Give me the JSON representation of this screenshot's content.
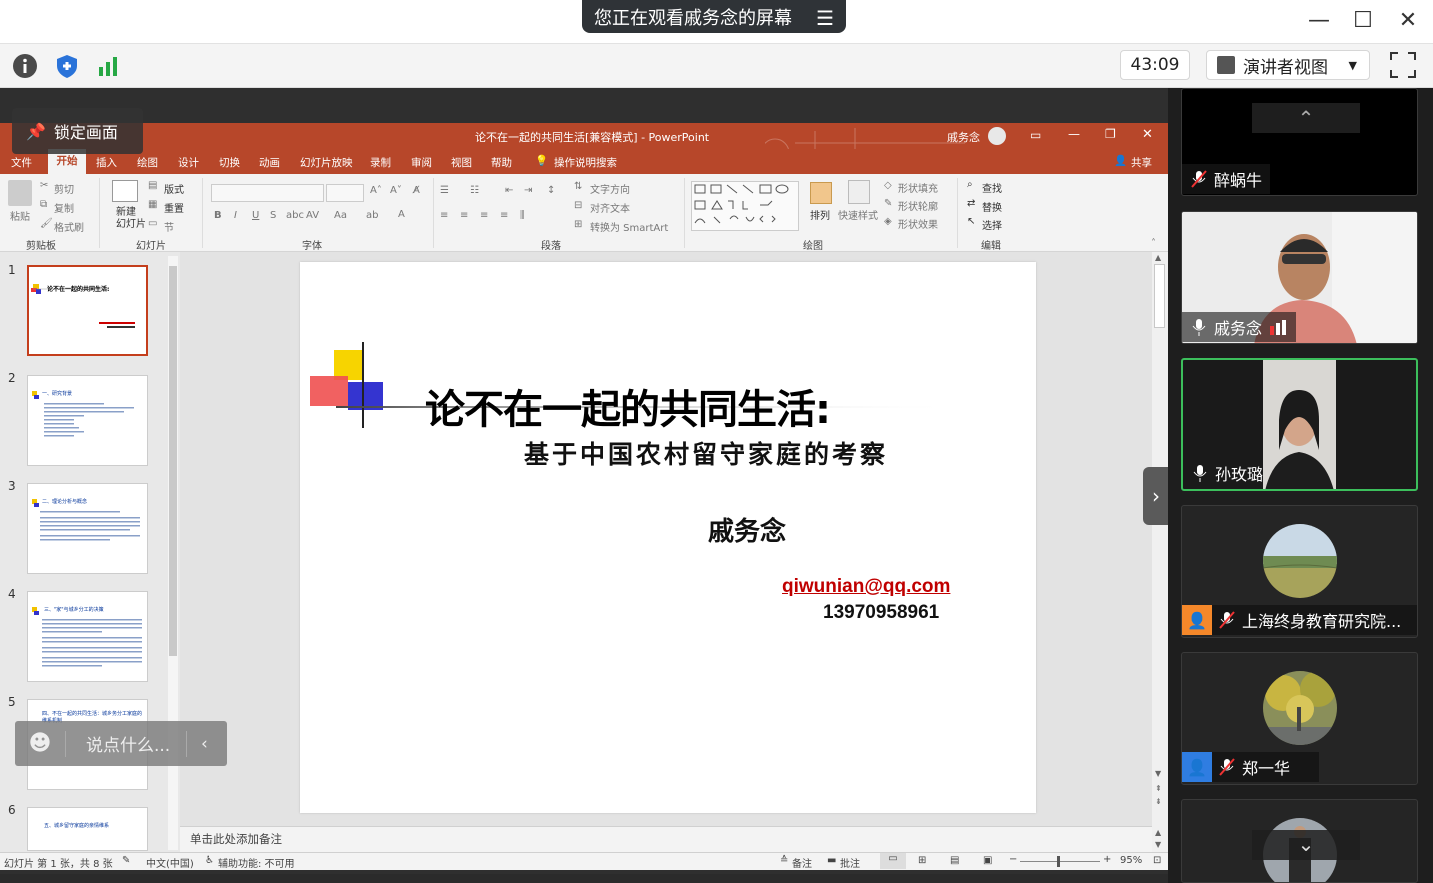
{
  "window": {
    "share_banner": "您正在观看戚务念的屏幕",
    "timer": "43:09",
    "view_mode": "演讲者视图"
  },
  "overlays": {
    "lock_label": "锁定画面",
    "chat_placeholder": "说点什么..."
  },
  "ppt": {
    "title": "论不在一起的共同生活[兼容模式] - PowerPoint",
    "user": "戚务念",
    "tabs": [
      "文件",
      "开始",
      "插入",
      "绘图",
      "设计",
      "切换",
      "动画",
      "幻灯片放映",
      "录制",
      "审阅",
      "视图",
      "帮助"
    ],
    "search_hint": "操作说明搜索",
    "share": "共享",
    "ribbon": {
      "clipboard": {
        "paste": "粘贴",
        "cut": "剪切",
        "copy": "复制",
        "format_painter": "格式刷",
        "group": "剪贴板"
      },
      "slides": {
        "new_slide": "新建\n幻灯片",
        "layout": "版式",
        "reset": "重置",
        "section": "节",
        "group": "幻灯片"
      },
      "font": {
        "group": "字体"
      },
      "paragraph": {
        "text_direction": "文字方向",
        "align_text": "对齐文本",
        "smartart": "转换为 SmartArt",
        "group": "段落"
      },
      "drawing": {
        "arrange": "排列",
        "quick_styles": "快速样式",
        "shape_fill": "形状填充",
        "shape_outline": "形状轮廓",
        "shape_effects": "形状效果",
        "group": "绘图"
      },
      "editing": {
        "find": "查找",
        "replace": "替换",
        "select": "选择",
        "group": "编辑"
      }
    },
    "thumbnails": [
      {
        "num": "1",
        "heading": "论不在一起的共同生活:"
      },
      {
        "num": "2",
        "heading": "一、研究背景"
      },
      {
        "num": "3",
        "heading": "二、理论分析与概念"
      },
      {
        "num": "4",
        "heading": "三、\"家\"与城乡分工的决策"
      },
      {
        "num": "5",
        "heading": "四、不在一起的共同生活：城乡务分工家庭的维系机制"
      },
      {
        "num": "6",
        "heading": "五、城乡留守家庭的亲情维系"
      }
    ],
    "slide": {
      "title": "论不在一起的共同生活:",
      "subtitle": "基于中国农村留守家庭的考察",
      "author": "戚务念",
      "email": "qiwunian@qq.com",
      "phone": "13970958961"
    },
    "notes_placeholder": "单击此处添加备注",
    "status": {
      "slide_info": "幻灯片 第 1 张，共 8 张",
      "language": "中文(中国)",
      "accessibility": "辅助功能: 不可用",
      "notes": "备注",
      "comments": "批注",
      "zoom": "95%"
    }
  },
  "participants": [
    {
      "name": "醉蜗牛",
      "mic": "muted"
    },
    {
      "name": "戚务念",
      "mic": "speaking"
    },
    {
      "name": "孙玫璐",
      "mic": "on"
    },
    {
      "name": "上海终身教育研究院...",
      "mic": "muted"
    },
    {
      "name": "郑一华",
      "mic": "muted"
    }
  ],
  "colors": {
    "ppt_red": "#b7472a",
    "email_red": "#c00000",
    "active_speaker_border": "#3cbf5c",
    "avatar_orange": "#f5882a",
    "avatar_blue": "#2f7de1"
  }
}
